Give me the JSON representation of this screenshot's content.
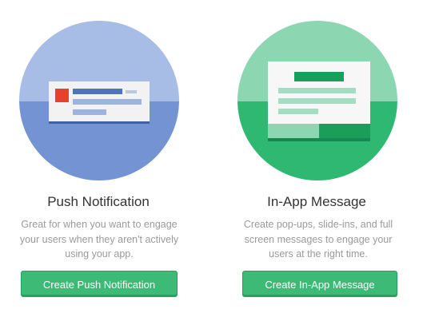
{
  "cards": [
    {
      "id": "push",
      "title": "Push Notification",
      "description": "Great for when you want to engage your users when they aren't actively using your app.",
      "button_label": "Create Push Notification"
    },
    {
      "id": "inapp",
      "title": "In-App Message",
      "description": "Create pop-ups, slide-ins, and full screen messages to engage your users at the right time.",
      "button_label": "Create In-App Message"
    }
  ],
  "colors": {
    "push_circle_top": "#a8bde6",
    "push_circle_bottom": "#7393d2",
    "push_accent": "#4c74c1",
    "push_icon_red": "#e8402f",
    "inapp_circle_top": "#8dd6b2",
    "inapp_circle_bottom": "#2fb872",
    "inapp_accent": "#17a05c",
    "button_green": "#3cba76"
  }
}
